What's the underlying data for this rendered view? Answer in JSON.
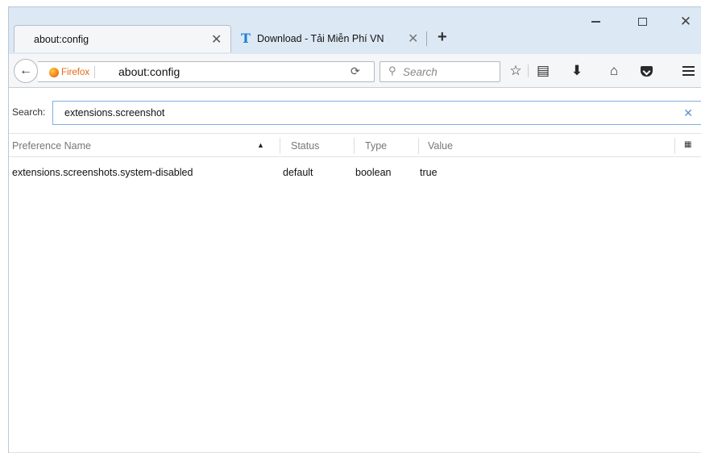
{
  "tabs": [
    {
      "title": "about:config",
      "active": true
    },
    {
      "title": "Download - Tải Miễn Phí VN",
      "active": false,
      "favicon": "T"
    }
  ],
  "window_controls": {
    "minimize": "minimize-icon",
    "maximize": "maximize-icon",
    "close": "close-icon"
  },
  "navbar": {
    "identity_label": "Firefox",
    "url": "about:config",
    "search_placeholder": "Search"
  },
  "config": {
    "filter_label": "Search:",
    "filter_value": "extensions.screenshot",
    "columns": [
      "Preference Name",
      "Status",
      "Type",
      "Value"
    ],
    "rows": [
      {
        "name": "extensions.screenshots.system-disabled",
        "status": "default",
        "type": "boolean",
        "value": "true"
      }
    ]
  },
  "colors": {
    "tabstrip": "#dde8f5",
    "accent": "#7faee3",
    "firefox_orange": "#e06a16"
  }
}
